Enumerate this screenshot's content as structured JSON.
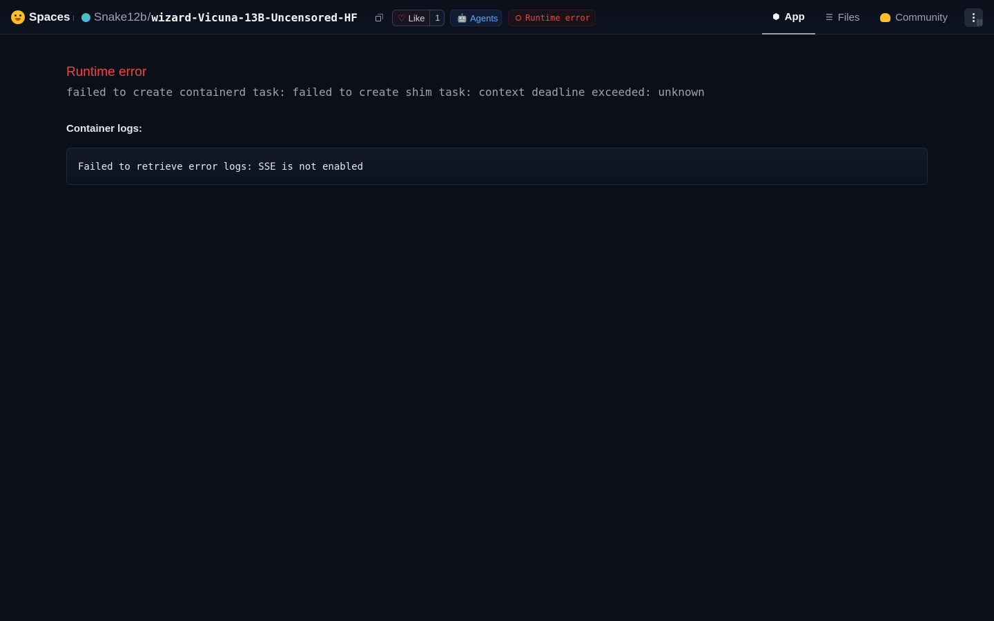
{
  "header": {
    "brand": "Spaces",
    "owner": "Snake12b",
    "separator": "/",
    "repo_name": "wizard-Vicuna-13B-Uncensored-HF",
    "like_label": "Like",
    "like_count": "1",
    "agents_label": "Agents",
    "status_label": "Runtime error"
  },
  "nav": {
    "app": "App",
    "files": "Files",
    "community": "Community"
  },
  "main": {
    "error_title": "Runtime error",
    "error_message": "failed to create containerd task: failed to create shim task: context deadline exceeded: unknown",
    "logs_title": "Container logs:",
    "logs_text": "Failed to retrieve error logs: SSE is not enabled"
  },
  "colors": {
    "background": "#0b0f19",
    "error": "#ef4444",
    "agents": "#60a5fa"
  },
  "icons": [
    "hugging-face-logo-icon",
    "copy-icon",
    "heart-icon",
    "robot-icon",
    "status-ring-icon",
    "cube-icon",
    "files-icon",
    "community-hand-icon",
    "more-vertical-icon",
    "link-icon"
  ]
}
